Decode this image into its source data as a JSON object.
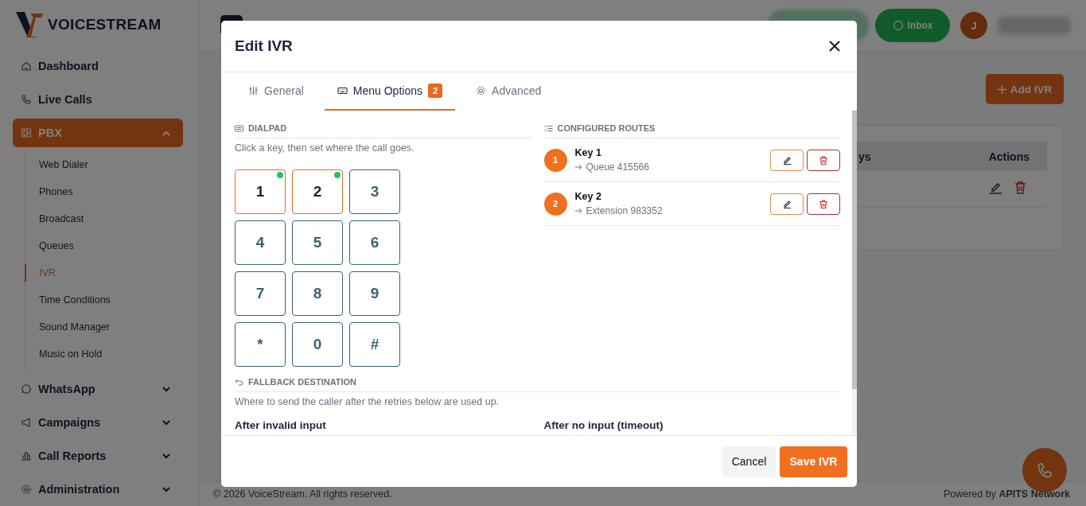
{
  "brand": {
    "name": "VOICESTREAM"
  },
  "sidebar": {
    "items": [
      {
        "label": "Dashboard",
        "selected": false
      },
      {
        "label": "Live Calls",
        "selected": false
      },
      {
        "label": "PBX",
        "selected": true,
        "expanded": true,
        "children": [
          {
            "label": "Web Dialer",
            "selected": false
          },
          {
            "label": "Phones",
            "selected": false
          },
          {
            "label": "Broadcast",
            "selected": false
          },
          {
            "label": "Queues",
            "selected": false
          },
          {
            "label": "IVR",
            "selected": true
          },
          {
            "label": "Time Conditions",
            "selected": false
          },
          {
            "label": "Sound Manager",
            "selected": false
          },
          {
            "label": "Music on Hold",
            "selected": false
          }
        ]
      },
      {
        "label": "WhatsApp",
        "selected": false,
        "expanded": false
      },
      {
        "label": "Campaigns",
        "selected": false,
        "expanded": false
      },
      {
        "label": "Call Reports",
        "selected": false,
        "expanded": false
      },
      {
        "label": "Administration",
        "selected": false,
        "expanded": false
      }
    ]
  },
  "header": {
    "inbox": "Inbox",
    "avatar": "J"
  },
  "page": {
    "add_button": "Add IVR"
  },
  "table": {
    "columns": [
      "ys",
      "Actions"
    ]
  },
  "footer": {
    "copyright": "© 2026 VoiceStream. All rights reserved.",
    "powered": "Powered by **APITS Network**"
  },
  "modal": {
    "title": "Edit IVR",
    "tabs": [
      {
        "label": "General",
        "selected": false
      },
      {
        "label": "Menu Options",
        "selected": true,
        "badge": "2"
      },
      {
        "label": "Advanced",
        "selected": false
      }
    ],
    "dialpad": {
      "heading": "DIALPAD",
      "hint": "Click a key, then set where the call goes.",
      "keys": [
        {
          "label": "1",
          "configured": true
        },
        {
          "label": "2",
          "configured": true
        },
        {
          "label": "3",
          "configured": false
        },
        {
          "label": "4",
          "configured": false
        },
        {
          "label": "5",
          "configured": false
        },
        {
          "label": "6",
          "configured": false
        },
        {
          "label": "7",
          "configured": false
        },
        {
          "label": "8",
          "configured": false
        },
        {
          "label": "9",
          "configured": false
        },
        {
          "label": "*",
          "configured": false
        },
        {
          "label": "0",
          "configured": false
        },
        {
          "label": "#",
          "configured": false
        }
      ]
    },
    "routes": {
      "heading": "CONFIGURED ROUTES",
      "items": [
        {
          "number": "1",
          "title": "Key 1",
          "destination": "Queue 415566"
        },
        {
          "number": "2",
          "title": "Key 2",
          "destination": "Extension 983352"
        }
      ]
    },
    "fallback": {
      "heading": "FALLBACK DESTINATION",
      "hint": "Where to send the caller after the retries below are used up.",
      "fields": [
        "After invalid input",
        "After no input (timeout)"
      ]
    },
    "buttons": {
      "cancel": "Cancel",
      "save": "Save IVR"
    }
  }
}
